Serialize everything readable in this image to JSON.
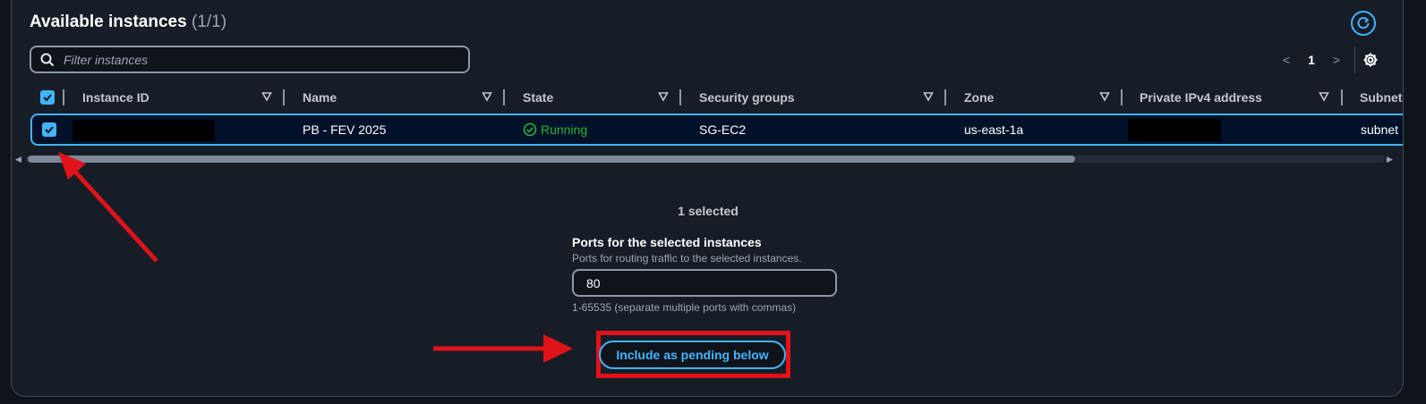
{
  "header": {
    "title": "Available instances",
    "count": "(1/1)"
  },
  "search": {
    "placeholder": "Filter instances",
    "value": ""
  },
  "pagination": {
    "current_page": "1",
    "prev_symbol": "<",
    "next_symbol": ">"
  },
  "table": {
    "columns": [
      "Instance ID",
      "Name",
      "State",
      "Security groups",
      "Zone",
      "Private IPv4 address",
      "Subnet"
    ],
    "rows": [
      {
        "selected": true,
        "instance_id": "",
        "name": "PB - FEV 2025",
        "state": "Running",
        "security_groups": "SG-EC2",
        "zone": "us-east-1a",
        "private_ipv4": "",
        "subnet": "subnet"
      }
    ]
  },
  "selection": {
    "summary": "1 selected"
  },
  "ports": {
    "label": "Ports for the selected instances",
    "description": "Ports for routing traffic to the selected instances.",
    "value": "80",
    "hint": "1-65535 (separate multiple ports with commas)"
  },
  "actions": {
    "include_label": "Include as pending below"
  },
  "colors": {
    "accent": "#42b4ff",
    "running": "#2bb534",
    "annotation": "#e0121a",
    "background": "#0f141a",
    "panel": "#161d26"
  }
}
